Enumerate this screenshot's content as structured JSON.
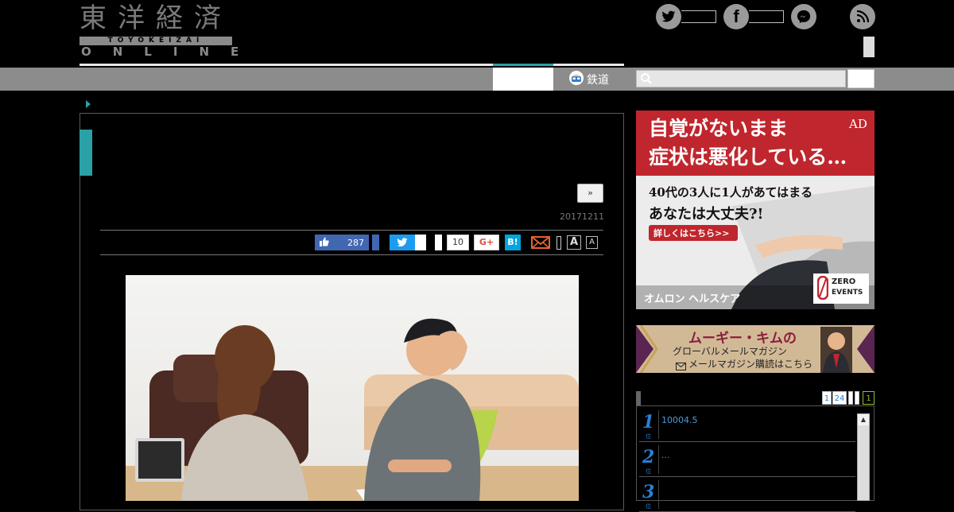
{
  "header": {
    "logo_kanji": "東洋経済",
    "logo_band": "TOYOKEIZAI",
    "logo_online": "ONLINE"
  },
  "nav": {
    "tetsudo_label": "鉄道",
    "search_placeholder": ""
  },
  "article": {
    "next_label": "»",
    "date": "20171211",
    "share": {
      "like_count": "287",
      "share_count": "10",
      "gplus_label": "G+",
      "hatena_label": "B!"
    },
    "font_large_label": "A",
    "font_small_label": "A"
  },
  "ads": {
    "omron": {
      "headline_line1": "自覚がないまま",
      "headline_line2": "症状は悪化している…",
      "ad_label": "AD",
      "sub_line1": "40代の3人に1人があてはまる",
      "sub_line2": "あなたは大丈夫?!",
      "cta": "詳しくはこちら>>",
      "advertiser": "オムロン ヘルスケア",
      "badge_top": "ZERO",
      "badge_bottom": "EVENTS"
    },
    "mail": {
      "headline": "ムーギー・キムの",
      "subline": "グローバルメールマガジン",
      "cta": "メールマガジン購読はこちら"
    }
  },
  "ranking": {
    "tabs": [
      "1",
      "24",
      "",
      "",
      "1"
    ],
    "items": [
      {
        "rank": "1",
        "suffix": "位",
        "text": "10004.5"
      },
      {
        "rank": "2",
        "suffix": "位",
        "text": "..."
      },
      {
        "rank": "3",
        "suffix": "位",
        "text": ""
      }
    ],
    "scroll_up": "▲"
  },
  "colors": {
    "accent_teal": "#2aa1a6",
    "nav_gray": "#8c8c8c",
    "facebook_blue": "#4267b2",
    "twitter_blue": "#1d9bf0",
    "ranking_blue": "#2a7fd4",
    "ad_red": "#c0262d"
  }
}
